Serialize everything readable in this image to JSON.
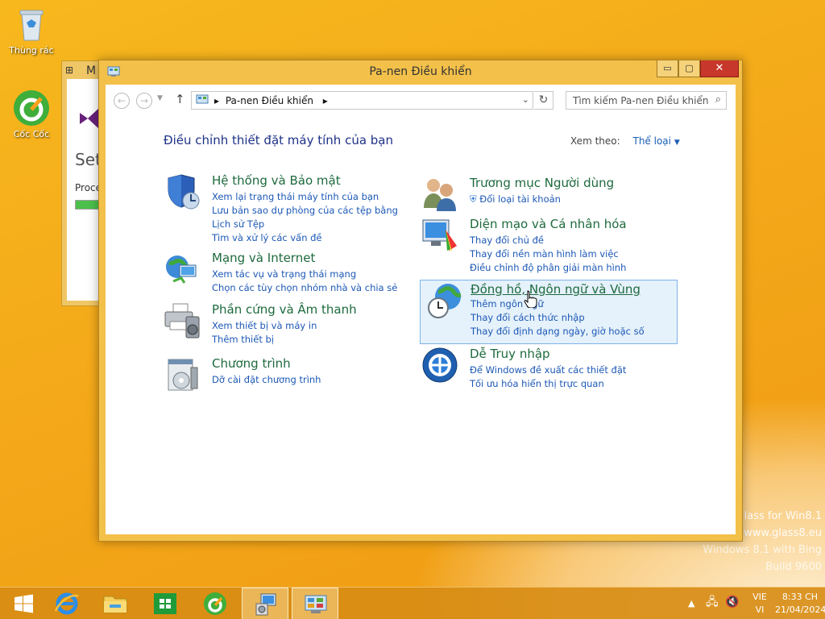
{
  "desktop": {
    "icons": [
      {
        "label": "Thùng rác",
        "icon": "recycle-bin-icon"
      },
      {
        "label": "Cốc Cốc",
        "icon": "coccoc-browser-icon"
      }
    ],
    "watermark": {
      "line1": "lass for Win8.1",
      "line2": "www.glass8.eu",
      "line3": "Windows 8.1 with Bing",
      "line4": "Build 9600"
    }
  },
  "background_window": {
    "title": "M",
    "text1": "Set",
    "text2": "Proce"
  },
  "window": {
    "title": "Pa-nen Điều khiển",
    "controls": {
      "minimize": "▭",
      "maximize": "▢",
      "close": "✕"
    },
    "nav": {
      "breadcrumb": "Pa-nen Điều khiển",
      "search_placeholder": "Tìm kiếm Pa-nen Điều khiển"
    },
    "heading": "Điều chỉnh thiết đặt máy tính của bạn",
    "view_by": {
      "label": "Xem theo:",
      "value": "Thể loại"
    },
    "categories_left": [
      {
        "title": "Hệ thống và Bảo mật",
        "icon": "shield-icon",
        "links": [
          "Xem lại trạng thái máy tính của bạn",
          "Lưu bản sao dự phòng của các tệp bằng Lịch sử Tệp",
          "Tìm và xử lý các vấn đề"
        ]
      },
      {
        "title": "Mạng và Internet",
        "icon": "network-globe-icon",
        "links": [
          "Xem tác vụ và trạng thái mạng",
          "Chọn các tùy chọn nhóm nhà và chia sẻ"
        ]
      },
      {
        "title": "Phần cứng và Âm thanh",
        "icon": "printer-icon",
        "links": [
          "Xem thiết bị và máy in",
          "Thêm thiết bị"
        ]
      },
      {
        "title": "Chương trình",
        "icon": "programs-icon",
        "links": [
          "Dỡ cài đặt chương trình"
        ]
      }
    ],
    "categories_right": [
      {
        "title": "Trương mục Người dùng",
        "icon": "users-icon",
        "links": [
          "Đổi loại tài khoản"
        ]
      },
      {
        "title": "Diện mạo và Cá nhân hóa",
        "icon": "monitor-palette-icon",
        "links": [
          "Thay đổi chủ đề",
          "Thay đổi nền màn hình làm việc",
          "Điều chỉnh độ phân giải màn hình"
        ]
      },
      {
        "title": "Đồng hồ, Ngôn ngữ và Vùng",
        "icon": "clock-globe-icon",
        "links": [
          "Thêm ngôn ngữ",
          "Thay đổi cách thức nhập",
          "Thay đổi định dạng ngày, giờ hoặc số"
        ]
      },
      {
        "title": "Dễ Truy nhập",
        "icon": "ease-of-access-icon",
        "links": [
          "Để Windows đề xuất các thiết đặt",
          "Tối ưu hóa hiển thị trực quan"
        ]
      }
    ]
  },
  "taskbar": {
    "buttons": [
      "start-icon",
      "internet-explorer-icon",
      "file-explorer-icon",
      "store-icon",
      "coccoc-icon",
      "setup-icon",
      "control-panel-icon"
    ],
    "tray": {
      "lang_top": "VIE",
      "lang_bottom": "VI",
      "time": "8:33 CH",
      "date": "21/04/2024"
    }
  }
}
